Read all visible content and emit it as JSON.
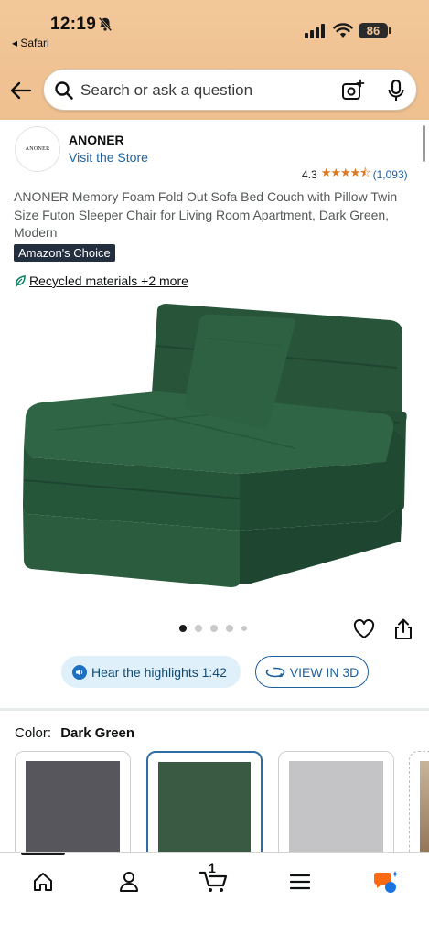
{
  "status_bar": {
    "time": "12:19",
    "back_app": "◂ Safari",
    "battery": "86"
  },
  "search": {
    "placeholder": "Search or ask a question"
  },
  "brand": {
    "logo_text": "ANONER",
    "name": "ANONER",
    "visit_store": "Visit the Store"
  },
  "rating": {
    "value": "4.3",
    "stars": "★★★★⯪",
    "count": "(1,093)"
  },
  "product": {
    "title": "ANONER Memory Foam Fold Out Sofa Bed Couch with Pillow Twin Size Futon Sleeper Chair for Living Room Apartment, Dark Green, Modern",
    "badge": "Amazon's Choice",
    "recycled": "Recycled materials +2 more",
    "image_alt": "Dark green fold out sofa bed chair with pillow"
  },
  "gallery": {
    "images_total": 5,
    "active_index": 0
  },
  "actions": {
    "hear_highlights": "Hear the highlights 1:42",
    "view_3d": "VIEW IN 3D"
  },
  "color": {
    "label": "Color:",
    "selected": "Dark Green",
    "swatches": [
      {
        "name": "Dark Gray",
        "hex": "#56565c"
      },
      {
        "name": "Dark Green",
        "hex": "#3a5a44"
      },
      {
        "name": "Light Gray",
        "hex": "#c4c4c6"
      }
    ]
  },
  "tabbar": {
    "cart_count": "1",
    "items": [
      "home",
      "account",
      "cart",
      "menu",
      "rufus"
    ]
  },
  "colors": {
    "header_bg": "#f2c89a",
    "link": "#2162a1",
    "star": "#de7921",
    "badge_bg": "#232f3e"
  }
}
